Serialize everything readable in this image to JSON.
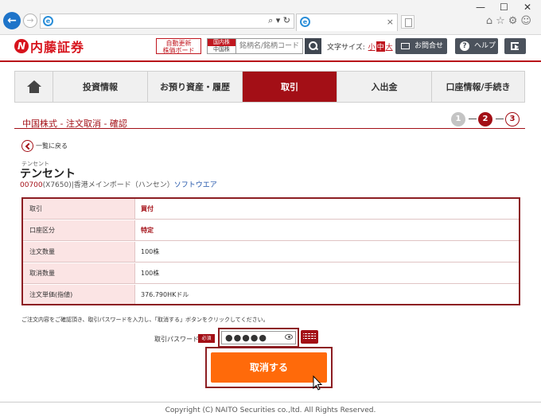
{
  "browser": {
    "window_controls": [
      "—",
      "☐",
      "✕"
    ],
    "address_tools": "⌕ ▾ ↻",
    "tab_close": "×"
  },
  "header": {
    "logo_text": "内藤証券",
    "logo_mark": "N",
    "auto_board": [
      "自動更新",
      "株価ボード"
    ],
    "market_top": "国内株",
    "market_bottom": "中国株",
    "search_placeholder": "銘柄名/銘柄コード",
    "font_size_label": "文字サイズ:",
    "font_sizes": [
      "小",
      "中",
      "大"
    ],
    "contact_label": "お問合せ",
    "help_label": "ヘルプ",
    "help_mark": "?"
  },
  "nav": {
    "items": [
      {
        "label": "投資情報"
      },
      {
        "label": "お預り資産・履歴"
      },
      {
        "label": "取引"
      },
      {
        "label": "入出金"
      },
      {
        "label": "口座情報/手続き"
      }
    ],
    "active_index": 3
  },
  "page": {
    "title": "中国株式 - 注文取消 - 確認",
    "steps": [
      "1",
      "2",
      "3"
    ],
    "current_step": 2,
    "back_label": "一覧に戻る"
  },
  "stock": {
    "kana": "テンセント",
    "name": "テンセント",
    "code": "00700",
    "meta": "(X7650)|香港メインボード（ハンセン）",
    "sector": "ソフトウエア"
  },
  "details": [
    {
      "label": "取引",
      "value": "買付",
      "emphasis": true
    },
    {
      "label": "口座区分",
      "value": "特定",
      "emphasis": true
    },
    {
      "label": "注文数量",
      "value": "100株",
      "emphasis": false
    },
    {
      "label": "取消数量",
      "value": "100株",
      "emphasis": false
    },
    {
      "label": "注文単価(指値)",
      "value": "376.790HKドル",
      "emphasis": false
    }
  ],
  "form": {
    "note": "ご注文内容をご確認頂き、取引パスワードを入力し、「取消する」ボタンをクリックしてください。",
    "password_label": "取引パスワード",
    "required_badge": "必須",
    "password_value": "●●●●●",
    "submit_label": "取消する"
  },
  "footer": {
    "copyright": "Copyright (C) NAITO Securities co.,ltd. All Rights Reserved."
  },
  "colors": {
    "brand_red": "#a30f16",
    "submit_orange": "#ff6a0a",
    "label_bg": "#fbe4e4"
  }
}
